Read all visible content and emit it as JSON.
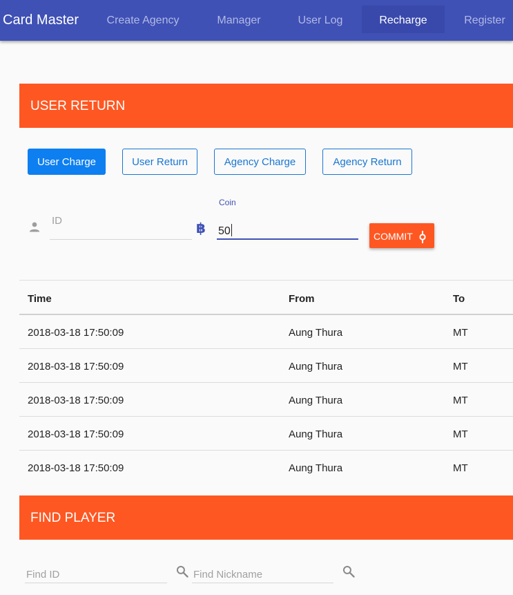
{
  "navbar": {
    "brand": "Card Master",
    "items": [
      {
        "label": "Create Agency",
        "active": false
      },
      {
        "label": "Manager",
        "active": false
      },
      {
        "label": "User Log",
        "active": false
      },
      {
        "label": "Recharge",
        "active": true
      },
      {
        "label": "Register",
        "active": false
      }
    ]
  },
  "user_return": {
    "title": "USER RETURN",
    "tabs": [
      {
        "label": "User Charge",
        "selected": true
      },
      {
        "label": "User Return",
        "selected": false
      },
      {
        "label": "Agency Charge",
        "selected": false
      },
      {
        "label": "Agency Return",
        "selected": false
      }
    ],
    "form": {
      "id_placeholder": "ID",
      "id_value": "",
      "coin_label": "Coin",
      "coin_value": "50",
      "commit_label": "COMMIT",
      "icons": {
        "id": "person-icon",
        "coin": "bitcoin-icon",
        "commit": "commit-icon"
      }
    },
    "table": {
      "columns": [
        "Time",
        "From",
        "To"
      ],
      "rows": [
        [
          "2018-03-18 17:50:09",
          "Aung Thura",
          "MT"
        ],
        [
          "2018-03-18 17:50:09",
          "Aung Thura",
          "MT"
        ],
        [
          "2018-03-18 17:50:09",
          "Aung Thura",
          "MT"
        ],
        [
          "2018-03-18 17:50:09",
          "Aung Thura",
          "MT"
        ],
        [
          "2018-03-18 17:50:09",
          "Aung Thura",
          "MT"
        ]
      ]
    }
  },
  "find_player": {
    "title": "FIND PLAYER",
    "id_placeholder": "Find ID",
    "nickname_placeholder": "Find Nickname",
    "icons": {
      "search": "search-icon"
    }
  },
  "colors": {
    "navbar": "#3f51b5",
    "nav_active": "#3949ab",
    "section_header": "#ff5722",
    "primary_button": "#0d7ff0",
    "outline_button": "#1976d2",
    "commit_button": "#ff5722"
  }
}
